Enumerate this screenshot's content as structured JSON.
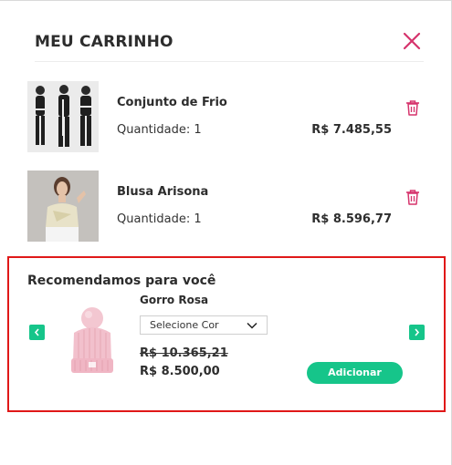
{
  "cart": {
    "title": "MEU CARRINHO",
    "items": [
      {
        "name": "Conjunto de Frio",
        "quantity": "Quantidade: 1",
        "price": "R$ 7.485,55"
      },
      {
        "name": "Blusa Arisona",
        "quantity": "Quantidade: 1",
        "price": "R$ 8.596,77"
      }
    ]
  },
  "recommendations": {
    "title": "Recomendamos para você",
    "product": {
      "name": "Gorro Rosa",
      "color_select": "Selecione Cor",
      "old_price": "R$ 10.365,21",
      "price": "R$ 8.500,00",
      "add_label": "Adicionar"
    }
  },
  "colors": {
    "accent_pink": "#d6336c",
    "accent_green": "#16c58a",
    "highlight_red": "#e01818"
  },
  "icons": [
    "close-icon",
    "trash-icon",
    "chevron-left-icon",
    "chevron-right-icon",
    "chevron-down-icon"
  ]
}
